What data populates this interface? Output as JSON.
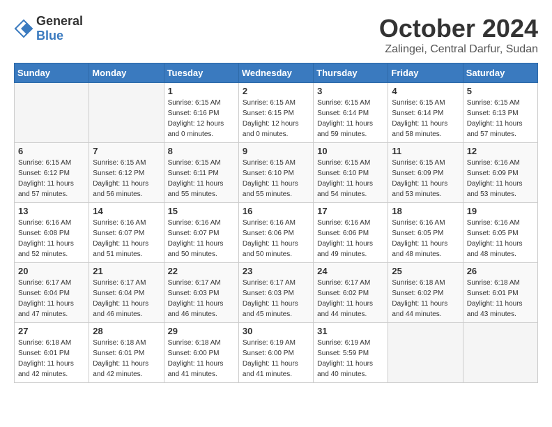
{
  "header": {
    "logo": {
      "general": "General",
      "blue": "Blue"
    },
    "title": "October 2024",
    "subtitle": "Zalingei, Central Darfur, Sudan"
  },
  "calendar": {
    "headers": [
      "Sunday",
      "Monday",
      "Tuesday",
      "Wednesday",
      "Thursday",
      "Friday",
      "Saturday"
    ],
    "weeks": [
      [
        {
          "day": "",
          "info": ""
        },
        {
          "day": "",
          "info": ""
        },
        {
          "day": "1",
          "info": "Sunrise: 6:15 AM\nSunset: 6:16 PM\nDaylight: 12 hours\nand 0 minutes."
        },
        {
          "day": "2",
          "info": "Sunrise: 6:15 AM\nSunset: 6:15 PM\nDaylight: 12 hours\nand 0 minutes."
        },
        {
          "day": "3",
          "info": "Sunrise: 6:15 AM\nSunset: 6:14 PM\nDaylight: 11 hours\nand 59 minutes."
        },
        {
          "day": "4",
          "info": "Sunrise: 6:15 AM\nSunset: 6:14 PM\nDaylight: 11 hours\nand 58 minutes."
        },
        {
          "day": "5",
          "info": "Sunrise: 6:15 AM\nSunset: 6:13 PM\nDaylight: 11 hours\nand 57 minutes."
        }
      ],
      [
        {
          "day": "6",
          "info": "Sunrise: 6:15 AM\nSunset: 6:12 PM\nDaylight: 11 hours\nand 57 minutes."
        },
        {
          "day": "7",
          "info": "Sunrise: 6:15 AM\nSunset: 6:12 PM\nDaylight: 11 hours\nand 56 minutes."
        },
        {
          "day": "8",
          "info": "Sunrise: 6:15 AM\nSunset: 6:11 PM\nDaylight: 11 hours\nand 55 minutes."
        },
        {
          "day": "9",
          "info": "Sunrise: 6:15 AM\nSunset: 6:10 PM\nDaylight: 11 hours\nand 55 minutes."
        },
        {
          "day": "10",
          "info": "Sunrise: 6:15 AM\nSunset: 6:10 PM\nDaylight: 11 hours\nand 54 minutes."
        },
        {
          "day": "11",
          "info": "Sunrise: 6:15 AM\nSunset: 6:09 PM\nDaylight: 11 hours\nand 53 minutes."
        },
        {
          "day": "12",
          "info": "Sunrise: 6:16 AM\nSunset: 6:09 PM\nDaylight: 11 hours\nand 53 minutes."
        }
      ],
      [
        {
          "day": "13",
          "info": "Sunrise: 6:16 AM\nSunset: 6:08 PM\nDaylight: 11 hours\nand 52 minutes."
        },
        {
          "day": "14",
          "info": "Sunrise: 6:16 AM\nSunset: 6:07 PM\nDaylight: 11 hours\nand 51 minutes."
        },
        {
          "day": "15",
          "info": "Sunrise: 6:16 AM\nSunset: 6:07 PM\nDaylight: 11 hours\nand 50 minutes."
        },
        {
          "day": "16",
          "info": "Sunrise: 6:16 AM\nSunset: 6:06 PM\nDaylight: 11 hours\nand 50 minutes."
        },
        {
          "day": "17",
          "info": "Sunrise: 6:16 AM\nSunset: 6:06 PM\nDaylight: 11 hours\nand 49 minutes."
        },
        {
          "day": "18",
          "info": "Sunrise: 6:16 AM\nSunset: 6:05 PM\nDaylight: 11 hours\nand 48 minutes."
        },
        {
          "day": "19",
          "info": "Sunrise: 6:16 AM\nSunset: 6:05 PM\nDaylight: 11 hours\nand 48 minutes."
        }
      ],
      [
        {
          "day": "20",
          "info": "Sunrise: 6:17 AM\nSunset: 6:04 PM\nDaylight: 11 hours\nand 47 minutes."
        },
        {
          "day": "21",
          "info": "Sunrise: 6:17 AM\nSunset: 6:04 PM\nDaylight: 11 hours\nand 46 minutes."
        },
        {
          "day": "22",
          "info": "Sunrise: 6:17 AM\nSunset: 6:03 PM\nDaylight: 11 hours\nand 46 minutes."
        },
        {
          "day": "23",
          "info": "Sunrise: 6:17 AM\nSunset: 6:03 PM\nDaylight: 11 hours\nand 45 minutes."
        },
        {
          "day": "24",
          "info": "Sunrise: 6:17 AM\nSunset: 6:02 PM\nDaylight: 11 hours\nand 44 minutes."
        },
        {
          "day": "25",
          "info": "Sunrise: 6:18 AM\nSunset: 6:02 PM\nDaylight: 11 hours\nand 44 minutes."
        },
        {
          "day": "26",
          "info": "Sunrise: 6:18 AM\nSunset: 6:01 PM\nDaylight: 11 hours\nand 43 minutes."
        }
      ],
      [
        {
          "day": "27",
          "info": "Sunrise: 6:18 AM\nSunset: 6:01 PM\nDaylight: 11 hours\nand 42 minutes."
        },
        {
          "day": "28",
          "info": "Sunrise: 6:18 AM\nSunset: 6:01 PM\nDaylight: 11 hours\nand 42 minutes."
        },
        {
          "day": "29",
          "info": "Sunrise: 6:18 AM\nSunset: 6:00 PM\nDaylight: 11 hours\nand 41 minutes."
        },
        {
          "day": "30",
          "info": "Sunrise: 6:19 AM\nSunset: 6:00 PM\nDaylight: 11 hours\nand 41 minutes."
        },
        {
          "day": "31",
          "info": "Sunrise: 6:19 AM\nSunset: 5:59 PM\nDaylight: 11 hours\nand 40 minutes."
        },
        {
          "day": "",
          "info": ""
        },
        {
          "day": "",
          "info": ""
        }
      ]
    ]
  }
}
